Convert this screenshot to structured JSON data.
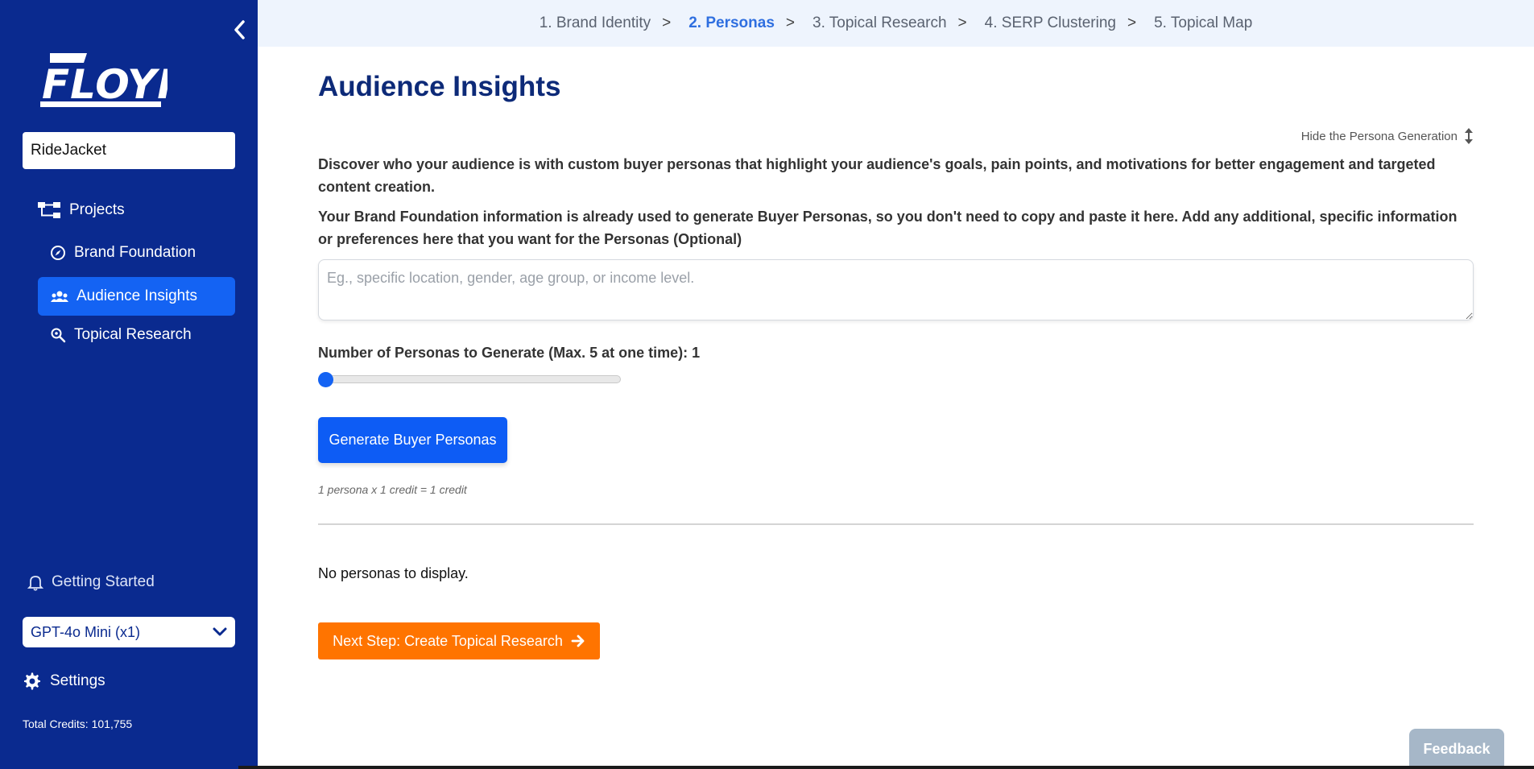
{
  "sidebar": {
    "logo_text": "FLOYI",
    "project_name": "RideJacket",
    "nav": {
      "projects": "Projects",
      "brand_foundation": "Brand Foundation",
      "audience_insights": "Audience Insights",
      "topical_research": "Topical Research"
    },
    "getting_started": "Getting Started",
    "model": "GPT-4o Mini (x1)",
    "settings": "Settings",
    "credits": "Total Credits: 101,755"
  },
  "steps": [
    {
      "label": "1. Brand Identity"
    },
    {
      "label": "2. Personas"
    },
    {
      "label": "3. Topical Research"
    },
    {
      "label": "4. SERP Clustering"
    },
    {
      "label": "5. Topical Map"
    }
  ],
  "step_separator": ">",
  "main": {
    "title": "Audience Insights",
    "hide_toggle": "Hide the Persona Generation",
    "description_1": "Discover who your audience is with custom buyer personas that highlight your audience's goals, pain points, and motivations for better engagement and targeted content creation.",
    "description_2": "Your Brand Foundation information is already used to generate Buyer Personas, so you don't need to copy and paste it here. Add any additional, specific information or preferences here that you want for the Personas (Optional)",
    "textarea_placeholder": "Eg., specific location, gender, age group, or income level.",
    "slider_label": "Number of Personas to Generate (Max. 5 at one time): 1",
    "slider_value": 1,
    "slider_max": 5,
    "generate_button": "Generate Buyer Personas",
    "credit_note": "1 persona x 1 credit = 1 credit",
    "empty_state": "No personas to display.",
    "next_button": "Next Step: Create Topical Research"
  },
  "feedback": "Feedback",
  "colors": {
    "sidebar_bg": "#0a2a8f",
    "primary": "#1463f3",
    "accent_orange": "#ff7400",
    "title": "#0d2a78"
  }
}
